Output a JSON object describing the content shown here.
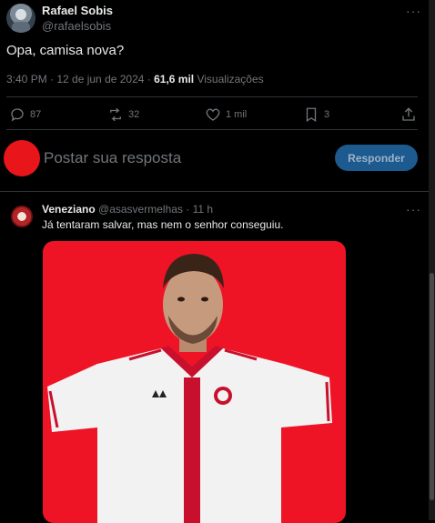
{
  "post": {
    "author_name": "Rafael Sobis",
    "author_handle": "@rafaelsobis",
    "more_label": "···",
    "text": "Opa, camisa nova?",
    "time": "3:40 PM · 12 de jun de 2024 · ",
    "views_count": "61,6 mil",
    "views_label": " Visualizações",
    "actions": {
      "replies": "87",
      "reposts": "32",
      "likes": "1 mil",
      "bookmarks": "3"
    }
  },
  "composer": {
    "placeholder": "Postar sua resposta",
    "button_label": "Responder",
    "avatar_color": "#e8161a",
    "button_color": "#1d5a8f"
  },
  "reply": {
    "author_name": "Veneziano",
    "author_handle": "@asasvermelhas",
    "time": "· 11 h",
    "more_label": "···",
    "text": "Já tentaram salvar, mas nem o senhor conseguiu.",
    "media_background": "#ee1426"
  },
  "colors": {
    "background": "#000000",
    "text_primary": "#e7e9ea",
    "text_secondary": "#71767b",
    "divider": "#2f3336"
  }
}
